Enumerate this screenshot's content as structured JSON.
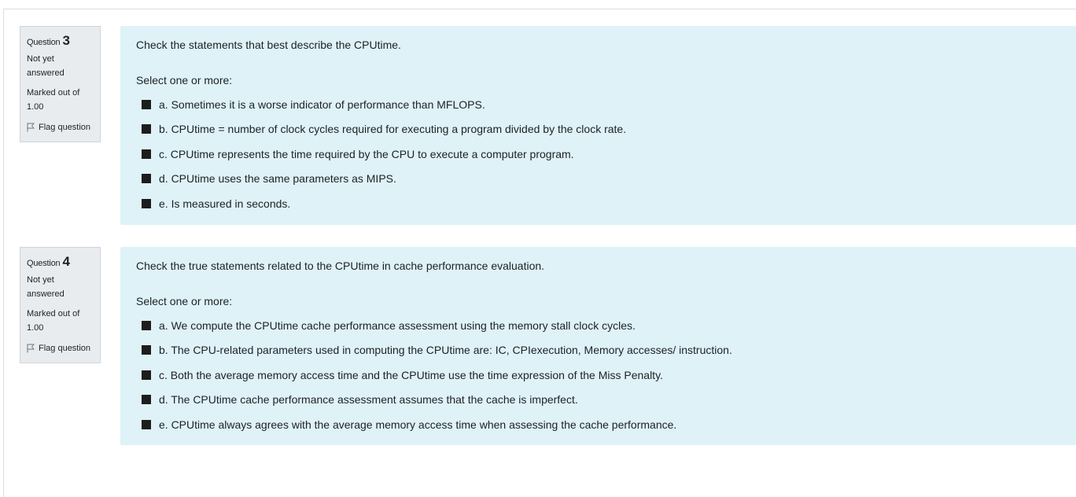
{
  "questions": [
    {
      "label": "Question",
      "number": "3",
      "state_line1": "Not yet",
      "state_line2": "answered",
      "grade": "Marked out of 1.00",
      "flag_label": "Flag question",
      "text": "Check the statements that best describe the CPUtime.",
      "prompt": "Select one or more:",
      "answers": [
        "a. Sometimes it is a worse indicator of performance than MFLOPS.",
        "b. CPUtime = number of clock cycles required for executing a program divided by the clock rate.",
        "c. CPUtime represents the time required by the CPU to execute a computer program.",
        "d. CPUtime uses the same parameters as MIPS.",
        "e. Is measured in seconds."
      ]
    },
    {
      "label": "Question",
      "number": "4",
      "state_line1": "Not yet",
      "state_line2": "answered",
      "grade": "Marked out of 1.00",
      "flag_label": "Flag question",
      "text": "Check the true statements related to the CPUtime in cache performance evaluation.",
      "prompt": "Select one or more:",
      "answers": [
        "a. We compute the CPUtime cache performance assessment using the memory stall clock cycles.",
        "b. The CPU-related parameters used in computing the CPUtime are: IC, CPIexecution, Memory accesses/ instruction.",
        "c. Both the average memory access time and the CPUtime use the time expression of the Miss Penalty.",
        "d. The CPUtime cache performance assessment assumes that the cache is imperfect.",
        "e. CPUtime always agrees with the average memory access time when assessing the cache performance."
      ]
    }
  ],
  "colors": {
    "info_bg": "#e9ecef",
    "content_bg": "#def2f8",
    "checkbox": "#1d1d1d",
    "text": "#1d2125"
  },
  "icons": {
    "flag": "flag-icon"
  }
}
